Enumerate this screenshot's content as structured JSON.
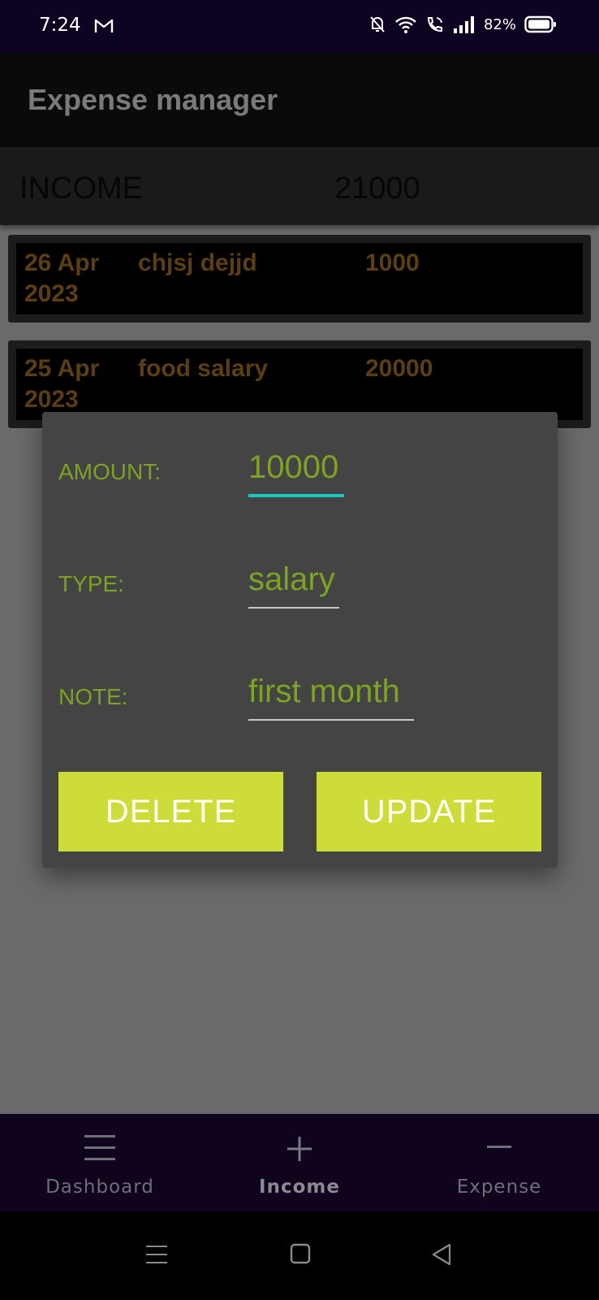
{
  "status_bar": {
    "time": "7:24",
    "battery": "82%",
    "icons": [
      "gmail-icon",
      "mute-bell-icon",
      "wifi-icon",
      "wifi-call-icon",
      "signal-icon",
      "battery-icon"
    ]
  },
  "app_bar": {
    "title": "Expense manager"
  },
  "summary": {
    "label": "INCOME",
    "value": "21000"
  },
  "transactions": [
    {
      "date": "26 Apr 2023",
      "note": "chjsj dejjd",
      "amount": "1000"
    },
    {
      "date": "25 Apr 2023",
      "note": "food salary",
      "amount": "20000"
    }
  ],
  "dialog": {
    "amount_label": "AMOUNT:",
    "amount_value": "10000",
    "type_label": "TYPE:",
    "type_value": "salary",
    "note_label": "NOTE:",
    "note_value": "first month",
    "delete_label": "DELETE",
    "update_label": "UPDATE"
  },
  "colors": {
    "accent_button": "#cddc39",
    "field_text": "#7ca321",
    "focus_underline": "#19c7c0",
    "nav_background": "#10031e"
  },
  "bottom_nav": {
    "items": [
      {
        "label": "Dashboard",
        "icon": "menu-icon",
        "active": false
      },
      {
        "label": "Income",
        "icon": "plus-icon",
        "active": true
      },
      {
        "label": "Expense",
        "icon": "minus-icon",
        "active": false
      }
    ]
  },
  "system_nav": {
    "icons": [
      "recents-icon",
      "home-icon",
      "back-icon"
    ]
  }
}
